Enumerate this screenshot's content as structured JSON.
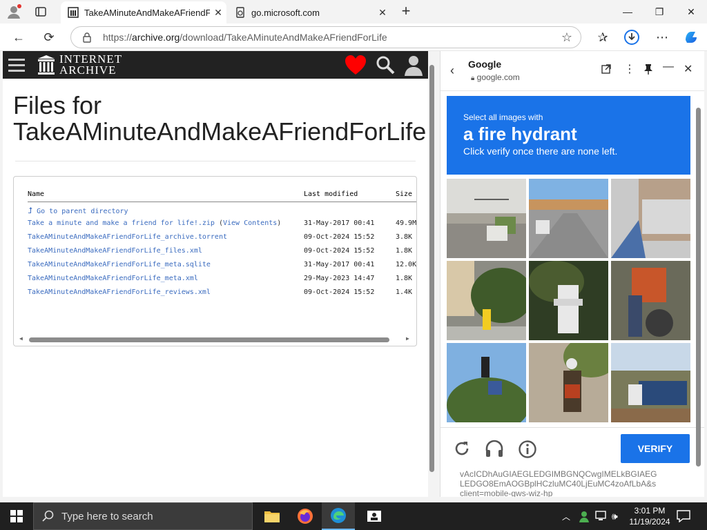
{
  "browser": {
    "tabs": [
      {
        "title": "TakeAMinuteAndMakeAFriendFor"
      },
      {
        "title": "go.microsoft.com"
      }
    ],
    "url_prefix": "https://",
    "url_host": "archive.org",
    "url_path": "/download/TakeAMinuteAndMakeAFriendForLife"
  },
  "archive": {
    "logo_line1": "INTERNET",
    "logo_line2": "ARCHIVE",
    "heading_line1": "Files for",
    "heading_line2": "TakeAMinuteAndMakeAFriendForLife",
    "columns": {
      "name": "Name",
      "modified": "Last modified",
      "size": "Size"
    },
    "parent_link": "Go to parent directory",
    "files": [
      {
        "name": "Take a minute and make a friend for life!.zip",
        "extra_open": " (",
        "extra_link": "View Contents",
        "extra_close": ")",
        "modified": "31-May-2017 00:41",
        "size": "49.9M"
      },
      {
        "name": "TakeAMinuteAndMakeAFriendForLife_archive.torrent",
        "extra_open": "",
        "extra_link": "",
        "extra_close": "",
        "modified": "09-Oct-2024 15:52",
        "size": "3.8K"
      },
      {
        "name": "TakeAMinuteAndMakeAFriendForLife_files.xml",
        "extra_open": "",
        "extra_link": "",
        "extra_close": "",
        "modified": "09-Oct-2024 15:52",
        "size": "1.8K"
      },
      {
        "name": "TakeAMinuteAndMakeAFriendForLife_meta.sqlite",
        "extra_open": "",
        "extra_link": "",
        "extra_close": "",
        "modified": "31-May-2017 00:41",
        "size": "12.0K"
      },
      {
        "name": "TakeAMinuteAndMakeAFriendForLife_meta.xml",
        "extra_open": "",
        "extra_link": "",
        "extra_close": "",
        "modified": "29-May-2023 14:47",
        "size": "1.8K"
      },
      {
        "name": "TakeAMinuteAndMakeAFriendForLife_reviews.xml",
        "extra_open": "",
        "extra_link": "",
        "extra_close": "",
        "modified": "09-Oct-2024 15:52",
        "size": "1.4K"
      }
    ]
  },
  "side_panel": {
    "site_name": "Google",
    "site_host": "google.com",
    "captcha": {
      "line1": "Select all images with",
      "target": "a fire hydrant",
      "line3": "Click verify once there are none left.",
      "verify_label": "VERIFY",
      "footer_text_1": "vAcICDhAuGIAEGLEDGIMBGNQCwgIMELkBGIAEG",
      "footer_text_2": "LEDGO8EmAOGBplHCzluMC40LjEuMC4zoAfLbA&s",
      "footer_text_3": "client=mobile-gws-wiz-hp"
    }
  },
  "taskbar": {
    "search_placeholder": "Type here to search",
    "time": "3:01 PM",
    "date": "11/19/2024"
  },
  "colors": {
    "accent": "#1a73e8",
    "heart": "#ff0000",
    "link": "#3a6bbf"
  }
}
